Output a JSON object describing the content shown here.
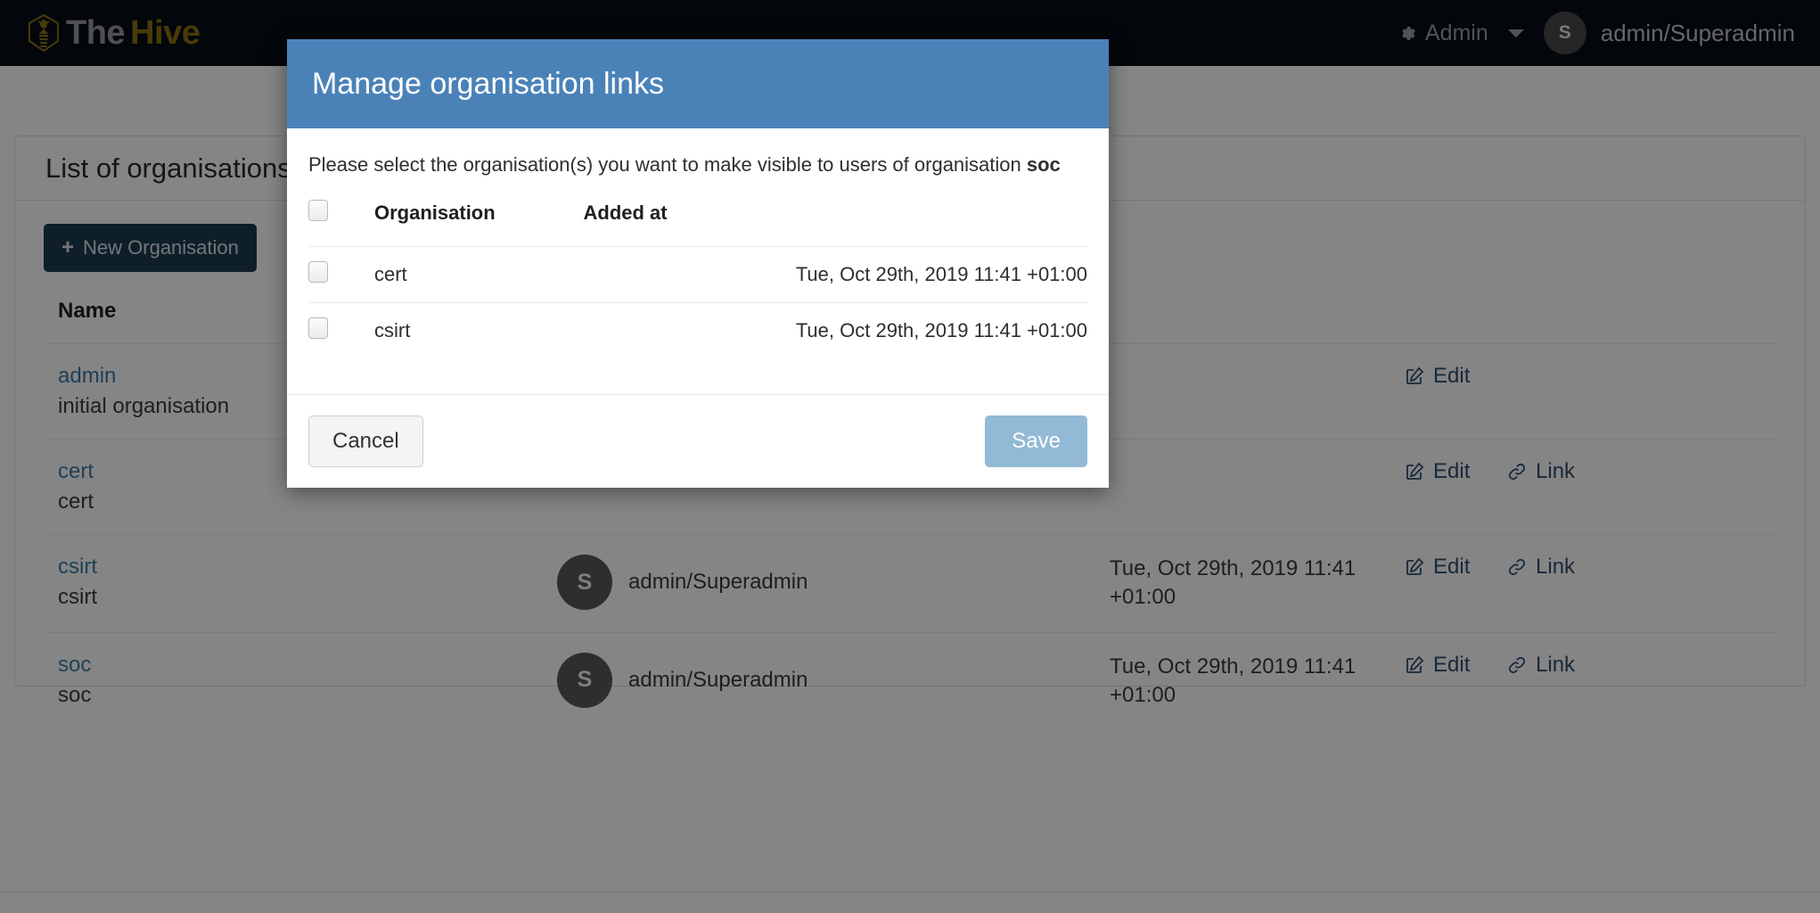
{
  "navbar": {
    "brand_the": "The",
    "brand_hive": "Hive",
    "admin_label": "Admin",
    "avatar_initial": "S",
    "username": "admin/Superadmin"
  },
  "panel": {
    "title": "List of organisations",
    "new_org_button": "New Organisation",
    "plus": "+",
    "columns": {
      "name": "Name"
    },
    "rows": [
      {
        "name": "admin",
        "description": "initial organisation",
        "user_initial": "",
        "user": "",
        "date": "",
        "edit": "Edit",
        "link": ""
      },
      {
        "name": "cert",
        "description": "cert",
        "user_initial": "",
        "user": "",
        "date": "",
        "edit": "Edit",
        "link": "Link"
      },
      {
        "name": "csirt",
        "description": "csirt",
        "user_initial": "S",
        "user": "admin/Superadmin",
        "date": "Tue, Oct 29th, 2019 11:41 +01:00",
        "edit": "Edit",
        "link": "Link"
      },
      {
        "name": "soc",
        "description": "soc",
        "user_initial": "S",
        "user": "admin/Superadmin",
        "date": "Tue, Oct 29th, 2019 11:41 +01:00",
        "edit": "Edit",
        "link": "Link"
      }
    ]
  },
  "modal": {
    "title": "Manage organisation links",
    "intro_prefix": "Please select the organisation(s) you want to make visible to users of organisation ",
    "intro_org": "soc",
    "columns": {
      "organisation": "Organisation",
      "added_at": "Added at"
    },
    "rows": [
      {
        "organisation": "cert",
        "added_at": "Tue, Oct 29th, 2019 11:41 +01:00",
        "checked": false
      },
      {
        "organisation": "csirt",
        "added_at": "Tue, Oct 29th, 2019 11:41 +01:00",
        "checked": false
      }
    ],
    "cancel_label": "Cancel",
    "save_label": "Save"
  },
  "colors": {
    "navbar_bg": "#060c16",
    "brand_hive": "#8a7210",
    "modal_header": "#4a82b8",
    "save_button": "#92b9d6",
    "new_org_button": "#1d3c52",
    "link_text": "#3f7ba5",
    "action_text": "#2f5070"
  }
}
